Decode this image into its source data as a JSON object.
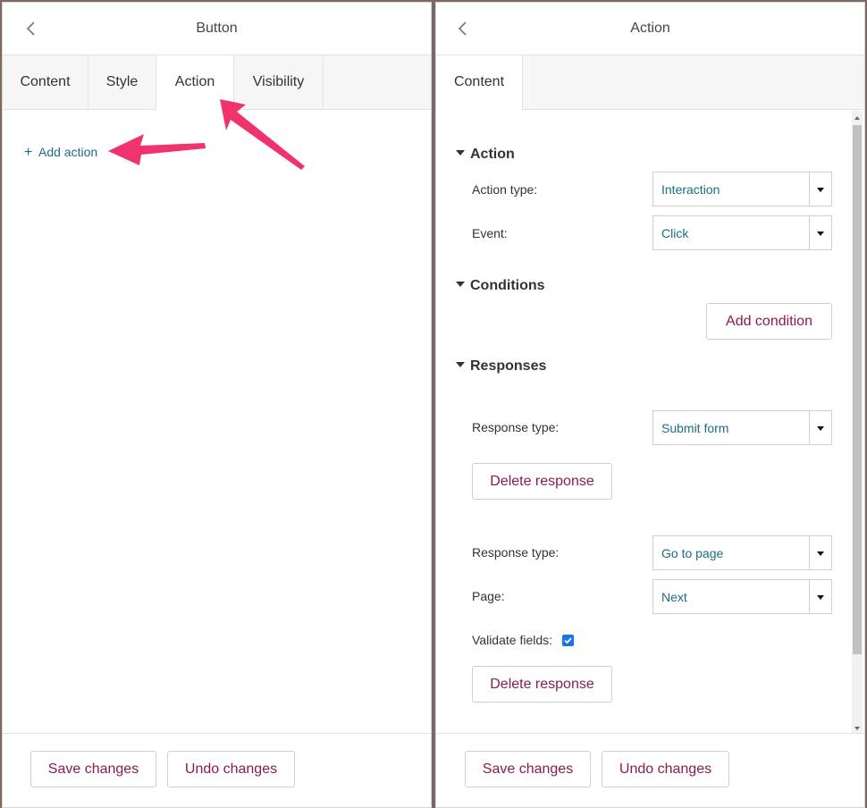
{
  "left_panel": {
    "title": "Button",
    "tabs": [
      {
        "label": "Content"
      },
      {
        "label": "Style"
      },
      {
        "label": "Action"
      },
      {
        "label": "Visibility"
      }
    ],
    "add_action": "Add action",
    "footer": {
      "save": "Save changes",
      "undo": "Undo changes"
    }
  },
  "right_panel": {
    "title": "Action",
    "tabs": [
      {
        "label": "Content"
      }
    ],
    "action_section": {
      "heading": "Action",
      "action_type_label": "Action type:",
      "action_type_value": "Interaction",
      "event_label": "Event:",
      "event_value": "Click"
    },
    "conditions_section": {
      "heading": "Conditions",
      "add_condition": "Add condition"
    },
    "responses_section": {
      "heading": "Responses",
      "responses": [
        {
          "type_label": "Response type:",
          "type_value": "Submit form",
          "delete": "Delete response"
        },
        {
          "type_label": "Response type:",
          "type_value": "Go to page",
          "page_label": "Page:",
          "page_value": "Next",
          "validate_label": "Validate fields:",
          "validate_checked": true,
          "delete": "Delete response"
        }
      ]
    },
    "footer": {
      "save": "Save changes",
      "undo": "Undo changes"
    }
  },
  "colors": {
    "accent_text": "#8b1a53",
    "link_teal": "#1b6d84",
    "annotation_arrow": "#f0336c",
    "checkbox": "#1a73e8"
  }
}
